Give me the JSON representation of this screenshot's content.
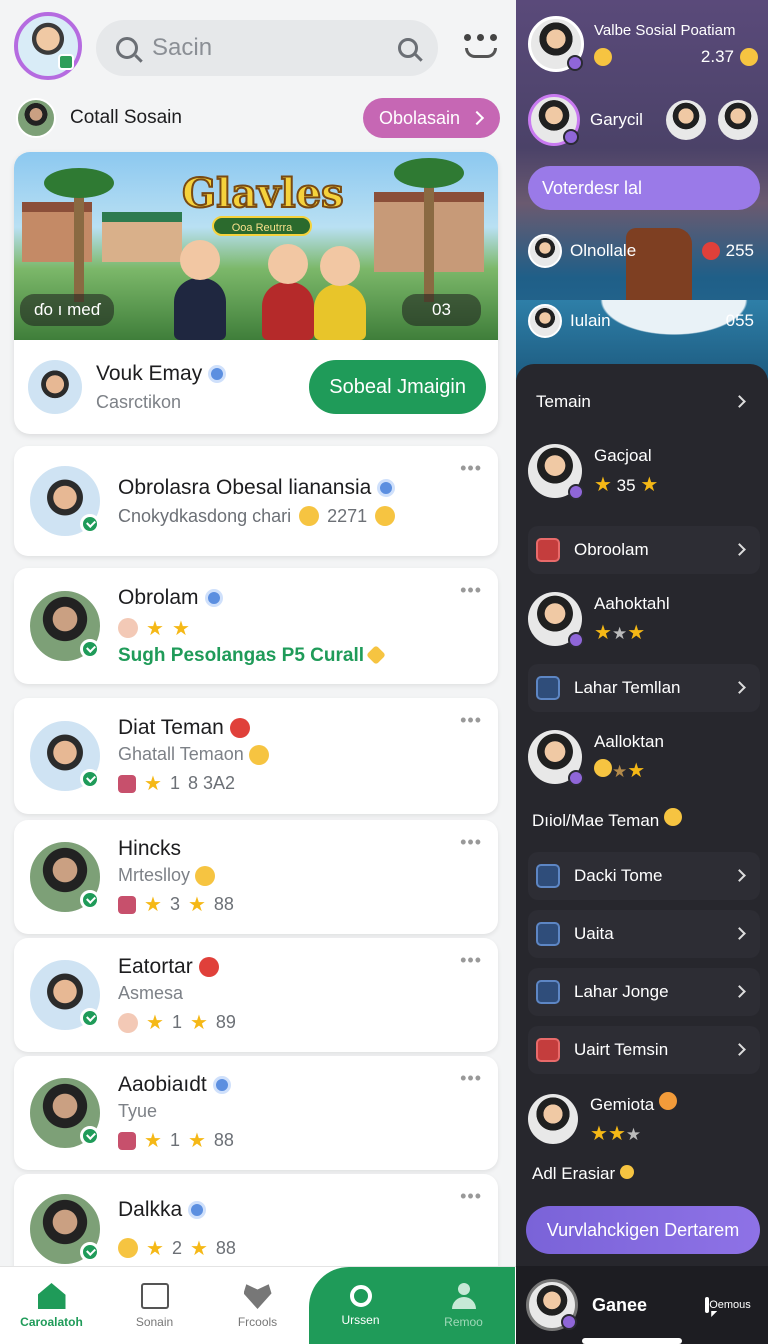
{
  "header": {
    "search_placeholder": "Sacin"
  },
  "group_row": {
    "title": "Cotall Sosain",
    "button": "Obolasain"
  },
  "hero": {
    "game_title": "Glavles",
    "game_subtitle": "Ooa Reutrra",
    "left_tag": "ɗo ı meɗ",
    "right_tag": "03",
    "user_name": "Vouk Emay",
    "user_sub": "Casrctikon",
    "action": "Sobeal Jmaigin"
  },
  "friends": [
    {
      "name": "Obrolasra Obesal lianansia",
      "sub": "Cnokydkasdong chari",
      "meta": "2271"
    },
    {
      "name": "Obrolam",
      "sub": "",
      "highlight": "Sugh Pesolangas P5 Curall"
    },
    {
      "name": "Diat Teman",
      "sub": "Ghatall Temaon",
      "meta1": "1",
      "meta2": "8 3A2"
    },
    {
      "name": "Hincks",
      "sub": "Mrteslloy",
      "meta1": "3",
      "meta2": "88"
    },
    {
      "name": "Eatortar",
      "sub": "Asmesa",
      "meta1": "1",
      "meta2": "89"
    },
    {
      "name": "Aaobiaıdt",
      "sub": "Tyue",
      "meta1": "1",
      "meta2": "88"
    },
    {
      "name": "Dalkka",
      "sub": "",
      "meta1": "2",
      "meta2": "88"
    }
  ],
  "nav": {
    "home": "Caroalatoh",
    "social": "Sonain",
    "friends": "Frcools",
    "search": "Urssen",
    "profile": "Remoo"
  },
  "right": {
    "top_title": "Valbe Sosial Poatiam",
    "top_count": "2.37",
    "second_name": "Garycil",
    "lav_button": "Voterdesr lal",
    "item1_name": "Olnollale",
    "item1_count": "255",
    "item2_name": "Iulain",
    "item2_count": "055",
    "section": "Temain",
    "f1_name": "Gacjoal",
    "f1_score": "35",
    "menu_a": "Obroolam",
    "f2_name": "Aahoktahl",
    "menu_b": "Lahar Temllan",
    "f3_name": "Aalloktan",
    "caption": "Dıiol/Mae Teman",
    "menu_c": "Dacki Tome",
    "menu_d": "Uaita",
    "menu_e": "Lahar Jonge",
    "menu_f": "Uairt Temsin",
    "f4_name": "Gemiota",
    "add_label": "Adl Erasiar",
    "cta": "Vurvlahckigen Dertarem",
    "bottom_name": "Ganee",
    "bottom_label": "Oemous"
  }
}
